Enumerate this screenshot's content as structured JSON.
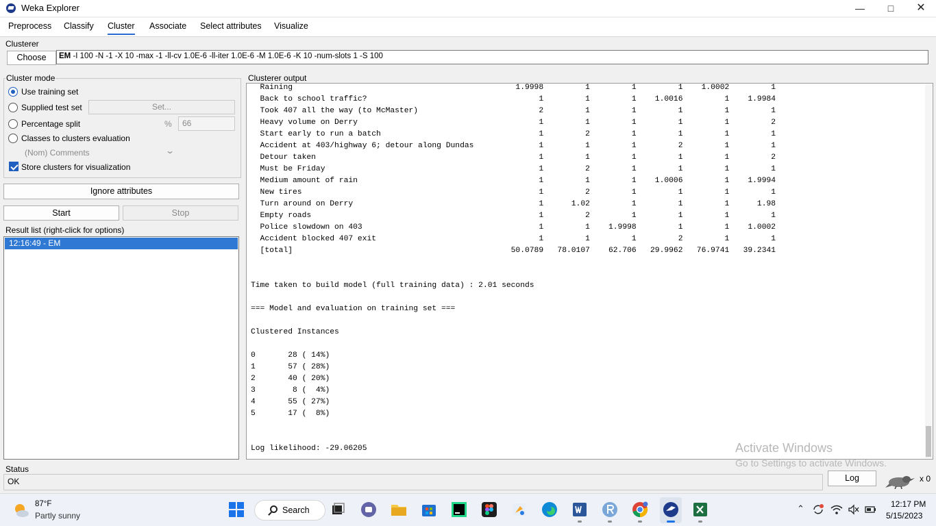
{
  "window": {
    "title": "Weka Explorer",
    "minimize_glyph": "—",
    "maximize_glyph": "□",
    "close_glyph": "✕"
  },
  "tabs": [
    {
      "label": "Preprocess"
    },
    {
      "label": "Classify"
    },
    {
      "label": "Cluster",
      "active": true
    },
    {
      "label": "Associate"
    },
    {
      "label": "Select attributes"
    },
    {
      "label": "Visualize"
    }
  ],
  "clusterer": {
    "group_label": "Clusterer",
    "choose_label": "Choose",
    "algorithm": "EM",
    "options": " -I 100 -N -1 -X 10 -max -1 -ll-cv 1.0E-6 -ll-iter 1.0E-6 -M 1.0E-6 -K 10 -num-slots 1 -S 100"
  },
  "cluster_mode": {
    "group_label": "Cluster mode",
    "use_training_set": "Use training set",
    "supplied_test_set": "Supplied test set",
    "set_button": "Set...",
    "percentage_split": "Percentage split",
    "percent_sign": "%",
    "percentage_value": "66",
    "classes_to_clusters": "Classes to clusters evaluation",
    "class_attribute": "(Nom) Comments",
    "store_clusters": "Store clusters for visualization",
    "selected": "Use training set"
  },
  "buttons": {
    "ignore_attributes": "Ignore attributes",
    "start": "Start",
    "stop": "Stop"
  },
  "result_list": {
    "group_label": "Result list (right-click for options)",
    "items": [
      "12:16:49 - EM"
    ]
  },
  "output": {
    "group_label": "Clusterer output",
    "text": "  Raining                                                1.9998         1         1         1    1.0002         1\n  Back to school traffic?                                     1         1         1    1.0016         1    1.9984\n  Took 407 all the way (to McMaster)                          2         1         1         1         1         1\n  Heavy volume on Derry                                       1         1         1         1         1         2\n  Start early to run a batch                                  1         2         1         1         1         1\n  Accident at 403/highway 6; detour along Dundas              1         1         1         2         1         1\n  Detour taken                                                1         1         1         1         1         2\n  Must be Friday                                              1         2         1         1         1         1\n  Medium amount of rain                                       1         1         1    1.0006         1    1.9994\n  New tires                                                   1         2         1         1         1         1\n  Turn around on Derry                                        1      1.02         1         1         1      1.98\n  Empty roads                                                 1         2         1         1         1         1\n  Police slowdown on 403                                      1         1    1.9998         1         1    1.0002\n  Accident blocked 407 exit                                   1         1         1         2         1         1\n  [total]                                               50.0789   78.0107    62.706   29.9962   76.9741   39.2341\n\n\nTime taken to build model (full training data) : 2.01 seconds\n\n=== Model and evaluation on training set ===\n\nClustered Instances\n\n0       28 ( 14%)\n1       57 ( 28%)\n2       40 ( 20%)\n3        8 (  4%)\n4       55 ( 27%)\n5       17 (  8%)\n\n\nLog likelihood: -29.06205"
  },
  "watermark": {
    "line1": "Activate Windows",
    "line2": "Go to Settings to activate Windows."
  },
  "status": {
    "group_label": "Status",
    "text": "OK",
    "log_button": "Log",
    "task_count": "x 0"
  },
  "taskbar": {
    "weather_temp": "87°F",
    "weather_desc": "Partly sunny",
    "search_label": "Search",
    "time": "12:17 PM",
    "date": "5/15/2023",
    "apps": [
      "start-icon",
      "task-view-icon",
      "chat-icon",
      "file-explorer-icon",
      "store-icon",
      "pycharm-icon",
      "figma-icon",
      "paint-icon",
      "edge-icon",
      "word-icon",
      "r-icon",
      "chrome-icon",
      "weka-icon",
      "excel-icon"
    ]
  }
}
